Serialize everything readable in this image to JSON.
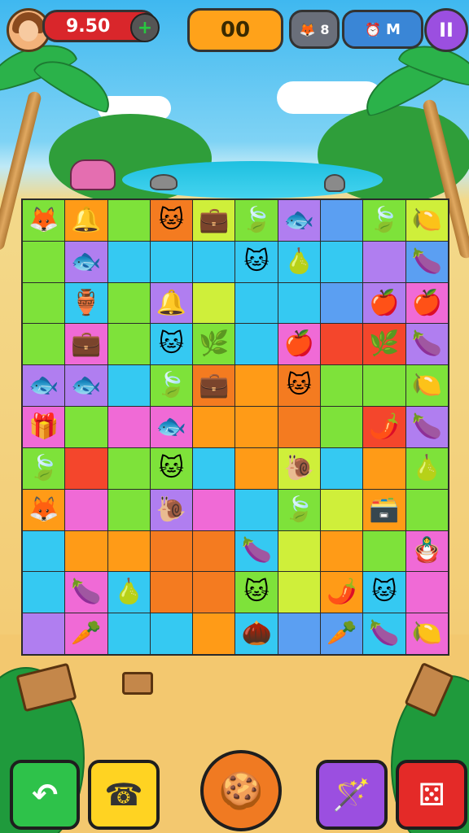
{
  "hud": {
    "score": "9.50",
    "score_plus": "+",
    "moves": "00",
    "coin_value": "8",
    "clock_value": "M",
    "pause_label": "II"
  },
  "colors": {
    "G": "#7ee23a",
    "C": "#35c9f2",
    "O": "#ff9b17",
    "D": "#f47b20",
    "P": "#b07ef0",
    "M": "#f06ad6",
    "Y": "#cfef3a",
    "B": "#5b9ff2",
    "R": "#f4462c",
    "L": "#55e0f5"
  },
  "board": {
    "rows": [
      [
        {
          "c": "G",
          "i": "🦊"
        },
        {
          "c": "O",
          "i": "🔔"
        },
        {
          "c": "G",
          "i": ""
        },
        {
          "c": "D",
          "i": "🐱"
        },
        {
          "c": "Y",
          "i": "💼"
        },
        {
          "c": "G",
          "i": "🍃"
        },
        {
          "c": "P",
          "i": "🐟"
        },
        {
          "c": "B",
          "i": ""
        },
        {
          "c": "G",
          "i": "🍃"
        },
        {
          "c": "Y",
          "i": "🍋"
        }
      ],
      [
        {
          "c": "G",
          "i": ""
        },
        {
          "c": "P",
          "i": "🐟"
        },
        {
          "c": "C",
          "i": ""
        },
        {
          "c": "C",
          "i": ""
        },
        {
          "c": "C",
          "i": ""
        },
        {
          "c": "C",
          "i": "🐱"
        },
        {
          "c": "C",
          "i": "🍐"
        },
        {
          "c": "C",
          "i": ""
        },
        {
          "c": "P",
          "i": ""
        },
        {
          "c": "B",
          "i": "🍆"
        }
      ],
      [
        {
          "c": "G",
          "i": ""
        },
        {
          "c": "C",
          "i": "🏺"
        },
        {
          "c": "G",
          "i": ""
        },
        {
          "c": "P",
          "i": "🔔"
        },
        {
          "c": "Y",
          "i": ""
        },
        {
          "c": "C",
          "i": ""
        },
        {
          "c": "C",
          "i": ""
        },
        {
          "c": "B",
          "i": ""
        },
        {
          "c": "P",
          "i": "🍎"
        },
        {
          "c": "M",
          "i": "🍎"
        }
      ],
      [
        {
          "c": "G",
          "i": ""
        },
        {
          "c": "M",
          "i": "💼"
        },
        {
          "c": "G",
          "i": ""
        },
        {
          "c": "C",
          "i": "🐱"
        },
        {
          "c": "G",
          "i": "🌿"
        },
        {
          "c": "C",
          "i": ""
        },
        {
          "c": "M",
          "i": "🍎"
        },
        {
          "c": "R",
          "i": ""
        },
        {
          "c": "R",
          "i": "🌿"
        },
        {
          "c": "P",
          "i": "🍆"
        }
      ],
      [
        {
          "c": "P",
          "i": "🐟"
        },
        {
          "c": "P",
          "i": "🐟"
        },
        {
          "c": "C",
          "i": ""
        },
        {
          "c": "G",
          "i": "🍃"
        },
        {
          "c": "D",
          "i": "💼"
        },
        {
          "c": "O",
          "i": ""
        },
        {
          "c": "D",
          "i": "🐱"
        },
        {
          "c": "G",
          "i": ""
        },
        {
          "c": "G",
          "i": ""
        },
        {
          "c": "G",
          "i": "🍋"
        }
      ],
      [
        {
          "c": "M",
          "i": "🎁"
        },
        {
          "c": "G",
          "i": ""
        },
        {
          "c": "M",
          "i": ""
        },
        {
          "c": "M",
          "i": "🐟"
        },
        {
          "c": "O",
          "i": ""
        },
        {
          "c": "O",
          "i": ""
        },
        {
          "c": "D",
          "i": ""
        },
        {
          "c": "G",
          "i": ""
        },
        {
          "c": "R",
          "i": "🌶️"
        },
        {
          "c": "P",
          "i": "🍆"
        }
      ],
      [
        {
          "c": "G",
          "i": "🍃"
        },
        {
          "c": "R",
          "i": ""
        },
        {
          "c": "G",
          "i": ""
        },
        {
          "c": "G",
          "i": "🐱"
        },
        {
          "c": "C",
          "i": ""
        },
        {
          "c": "O",
          "i": ""
        },
        {
          "c": "Y",
          "i": "🐌"
        },
        {
          "c": "C",
          "i": ""
        },
        {
          "c": "O",
          "i": ""
        },
        {
          "c": "G",
          "i": "🍐"
        }
      ],
      [
        {
          "c": "O",
          "i": "🦊"
        },
        {
          "c": "M",
          "i": ""
        },
        {
          "c": "G",
          "i": ""
        },
        {
          "c": "P",
          "i": "🐌"
        },
        {
          "c": "M",
          "i": ""
        },
        {
          "c": "C",
          "i": ""
        },
        {
          "c": "G",
          "i": "🍃"
        },
        {
          "c": "Y",
          "i": ""
        },
        {
          "c": "O",
          "i": "🗃️"
        },
        {
          "c": "G",
          "i": ""
        }
      ],
      [
        {
          "c": "C",
          "i": ""
        },
        {
          "c": "O",
          "i": ""
        },
        {
          "c": "O",
          "i": ""
        },
        {
          "c": "D",
          "i": ""
        },
        {
          "c": "D",
          "i": ""
        },
        {
          "c": "C",
          "i": "🍆"
        },
        {
          "c": "Y",
          "i": ""
        },
        {
          "c": "O",
          "i": ""
        },
        {
          "c": "G",
          "i": ""
        },
        {
          "c": "M",
          "i": "🪆"
        }
      ],
      [
        {
          "c": "C",
          "i": ""
        },
        {
          "c": "M",
          "i": "🍆"
        },
        {
          "c": "C",
          "i": "🍐"
        },
        {
          "c": "D",
          "i": ""
        },
        {
          "c": "D",
          "i": ""
        },
        {
          "c": "G",
          "i": "🐱"
        },
        {
          "c": "Y",
          "i": ""
        },
        {
          "c": "O",
          "i": "🌶️"
        },
        {
          "c": "C",
          "i": "🐱"
        },
        {
          "c": "M",
          "i": ""
        }
      ],
      [
        {
          "c": "P",
          "i": ""
        },
        {
          "c": "M",
          "i": "🥕"
        },
        {
          "c": "C",
          "i": ""
        },
        {
          "c": "C",
          "i": ""
        },
        {
          "c": "O",
          "i": ""
        },
        {
          "c": "C",
          "i": "🌰"
        },
        {
          "c": "B",
          "i": ""
        },
        {
          "c": "B",
          "i": "🥕"
        },
        {
          "c": "C",
          "i": "🍆"
        },
        {
          "c": "M",
          "i": "🍋"
        }
      ]
    ]
  },
  "buttons": {
    "undo": "↶",
    "phone": "☎",
    "cookie": "🍪",
    "magic": "🪄",
    "dice": "⚄"
  }
}
